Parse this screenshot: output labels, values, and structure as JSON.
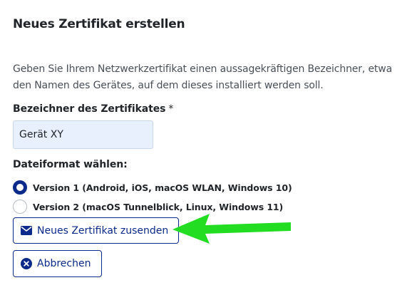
{
  "page": {
    "title": "Neues Zertifikat erstellen",
    "description": "Geben Sie Ihrem Netzwerkzertifikat einen aussagekräftigen Bezeichner, etwa den Namen des Gerätes, auf dem dieses installiert werden soll."
  },
  "form": {
    "name_label": "Bezeichner des Zertifikates",
    "required_marker": "*",
    "name_value": "Gerät XY",
    "format_label": "Dateiformat wählen:",
    "format_options": [
      {
        "label": "Version 1 (Android, iOS, macOS WLAN, Windows 10)",
        "checked": true
      },
      {
        "label": "Version 2 (macOS Tunnelblick, Linux, Windows 11)",
        "checked": false
      }
    ]
  },
  "actions": {
    "send_label": "Neues Zertifikat zusenden",
    "send_icon": "envelope-icon",
    "cancel_label": "Abbrechen",
    "cancel_icon": "close-circle-icon"
  },
  "annotation": {
    "arrow_color": "#22dd22"
  },
  "colors": {
    "accent": "#0b2a8a",
    "input_bg": "#e8f0fe"
  }
}
